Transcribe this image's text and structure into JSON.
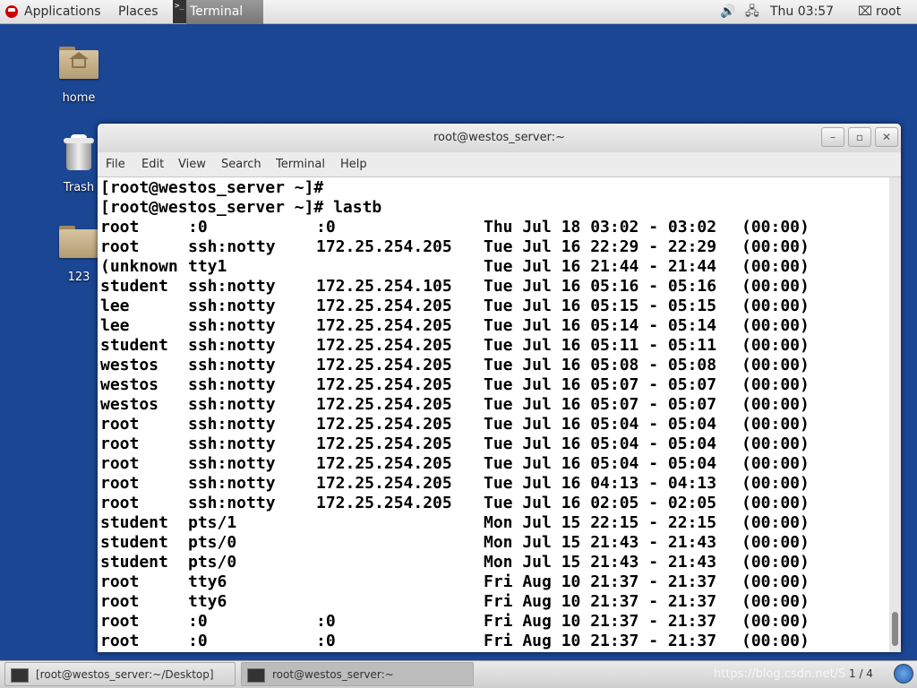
{
  "topbar": {
    "applications": "Applications",
    "places": "Places",
    "terminal": "Terminal",
    "clock": "Thu 03:57",
    "user": "root",
    "icons": [
      "volume-icon",
      "network-icon",
      "user-icon"
    ]
  },
  "desktop": {
    "icons": [
      {
        "label": "home",
        "icon": "home-folder-icon"
      },
      {
        "label": "Trash",
        "icon": "trash-icon"
      },
      {
        "label": "123",
        "icon": "folder-icon"
      }
    ]
  },
  "window": {
    "title": "root@westos_server:~",
    "menu": [
      "File",
      "Edit",
      "View",
      "Search",
      "Terminal",
      "Help"
    ]
  },
  "terminal": {
    "prompt_lines": [
      "[root@westos_server ~]#",
      "[root@westos_server ~]# lastb"
    ],
    "rows": [
      {
        "user": "root",
        "tty": ":0",
        "host": ":0",
        "time": "Thu Jul 18 03:02 - 03:02",
        "dur": "(00:00)"
      },
      {
        "user": "root",
        "tty": "ssh:notty",
        "host": "172.25.254.205",
        "time": "Tue Jul 16 22:29 - 22:29",
        "dur": "(00:00)"
      },
      {
        "user": "(unknown",
        "tty": "tty1",
        "host": "",
        "time": "Tue Jul 16 21:44 - 21:44",
        "dur": "(00:00)"
      },
      {
        "user": "student",
        "tty": "ssh:notty",
        "host": "172.25.254.105",
        "time": "Tue Jul 16 05:16 - 05:16",
        "dur": "(00:00)"
      },
      {
        "user": "lee",
        "tty": "ssh:notty",
        "host": "172.25.254.205",
        "time": "Tue Jul 16 05:15 - 05:15",
        "dur": "(00:00)"
      },
      {
        "user": "lee",
        "tty": "ssh:notty",
        "host": "172.25.254.205",
        "time": "Tue Jul 16 05:14 - 05:14",
        "dur": "(00:00)"
      },
      {
        "user": "student",
        "tty": "ssh:notty",
        "host": "172.25.254.205",
        "time": "Tue Jul 16 05:11 - 05:11",
        "dur": "(00:00)"
      },
      {
        "user": "westos",
        "tty": "ssh:notty",
        "host": "172.25.254.205",
        "time": "Tue Jul 16 05:08 - 05:08",
        "dur": "(00:00)"
      },
      {
        "user": "westos",
        "tty": "ssh:notty",
        "host": "172.25.254.205",
        "time": "Tue Jul 16 05:07 - 05:07",
        "dur": "(00:00)"
      },
      {
        "user": "westos",
        "tty": "ssh:notty",
        "host": "172.25.254.205",
        "time": "Tue Jul 16 05:07 - 05:07",
        "dur": "(00:00)"
      },
      {
        "user": "root",
        "tty": "ssh:notty",
        "host": "172.25.254.205",
        "time": "Tue Jul 16 05:04 - 05:04",
        "dur": "(00:00)"
      },
      {
        "user": "root",
        "tty": "ssh:notty",
        "host": "172.25.254.205",
        "time": "Tue Jul 16 05:04 - 05:04",
        "dur": "(00:00)"
      },
      {
        "user": "root",
        "tty": "ssh:notty",
        "host": "172.25.254.205",
        "time": "Tue Jul 16 05:04 - 05:04",
        "dur": "(00:00)"
      },
      {
        "user": "root",
        "tty": "ssh:notty",
        "host": "172.25.254.205",
        "time": "Tue Jul 16 04:13 - 04:13",
        "dur": "(00:00)"
      },
      {
        "user": "root",
        "tty": "ssh:notty",
        "host": "172.25.254.205",
        "time": "Tue Jul 16 02:05 - 02:05",
        "dur": "(00:00)"
      },
      {
        "user": "student",
        "tty": "pts/1",
        "host": "",
        "time": "Mon Jul 15 22:15 - 22:15",
        "dur": "(00:00)"
      },
      {
        "user": "student",
        "tty": "pts/0",
        "host": "",
        "time": "Mon Jul 15 21:43 - 21:43",
        "dur": "(00:00)"
      },
      {
        "user": "student",
        "tty": "pts/0",
        "host": "",
        "time": "Mon Jul 15 21:43 - 21:43",
        "dur": "(00:00)"
      },
      {
        "user": "root",
        "tty": "tty6",
        "host": "",
        "time": "Fri Aug 10 21:37 - 21:37",
        "dur": "(00:00)"
      },
      {
        "user": "root",
        "tty": "tty6",
        "host": "",
        "time": "Fri Aug 10 21:37 - 21:37",
        "dur": "(00:00)"
      },
      {
        "user": "root",
        "tty": ":0",
        "host": ":0",
        "time": "Fri Aug 10 21:37 - 21:37",
        "dur": "(00:00)"
      },
      {
        "user": "root",
        "tty": ":0",
        "host": ":0",
        "time": "Fri Aug 10 21:37 - 21:37",
        "dur": "(00:00)"
      }
    ]
  },
  "taskbar": {
    "tasks": [
      "[root@westos_server:~/Desktop]",
      "root@westos_server:~"
    ],
    "watermark": "https://blog.csdn.net/S",
    "pager": "1 / 4"
  },
  "colors": {
    "desktop": "#1a4694",
    "terminal_bg": "#ffffff",
    "terminal_fg": "#000000"
  }
}
